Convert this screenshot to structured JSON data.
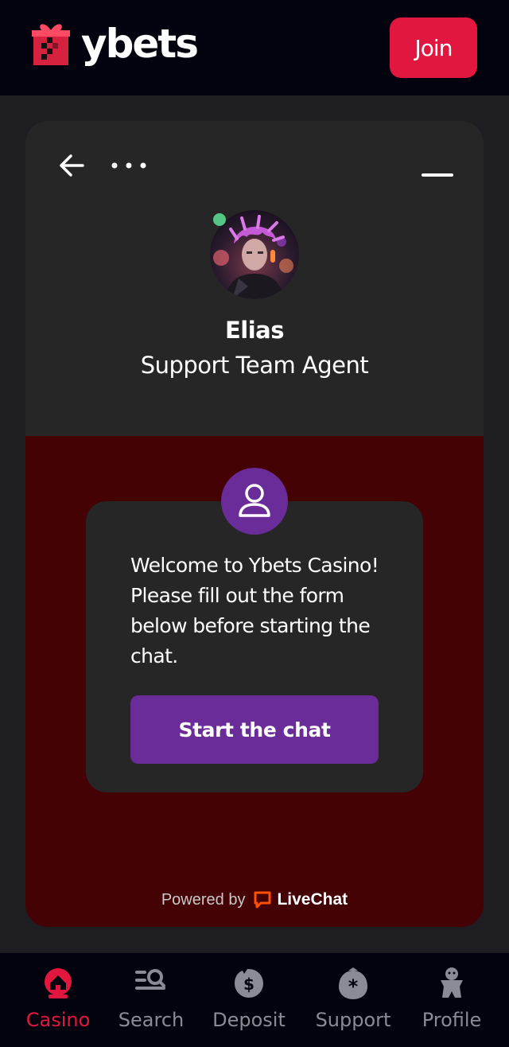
{
  "header": {
    "logo_text": "ybets",
    "join_label": "Join"
  },
  "chat": {
    "agent": {
      "name": "Elias",
      "role": "Support Team Agent",
      "status": "online"
    },
    "welcome_message": "Welcome to Ybets Casino! Please fill out the form below before starting the chat.",
    "start_button": "Start the chat",
    "powered_by": "Powered by",
    "provider": "LiveChat"
  },
  "bottom_nav": {
    "items": [
      {
        "label": "Casino",
        "icon": "casino-icon",
        "active": true
      },
      {
        "label": "Search",
        "icon": "search-icon",
        "active": false
      },
      {
        "label": "Deposit",
        "icon": "deposit-icon",
        "active": false
      },
      {
        "label": "Support",
        "icon": "support-icon",
        "active": false
      },
      {
        "label": "Profile",
        "icon": "profile-icon",
        "active": false
      }
    ]
  },
  "colors": {
    "brand_red": "#e2173f",
    "accent_purple": "#6a2c99",
    "chat_background": "#440205",
    "online_green": "#53c685",
    "livechat_orange": "#ff5100"
  }
}
